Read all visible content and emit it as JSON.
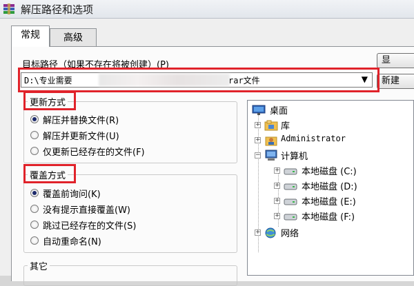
{
  "window": {
    "title": "解压路径和选项"
  },
  "tabs": [
    {
      "label": "常规"
    },
    {
      "label": "高级"
    }
  ],
  "path": {
    "label": "目标路径（如果不存在将被创建）(P)",
    "value_start": "D:\\专业需要",
    "value_end": "rar文件"
  },
  "side_buttons": [
    {
      "label": "显"
    },
    {
      "label": "新建"
    }
  ],
  "update_group": {
    "title": "更新方式",
    "options": [
      {
        "label": "解压并替换文件(R)",
        "checked": true
      },
      {
        "label": "解压并更新文件(U)",
        "checked": false
      },
      {
        "label": "仅更新已经存在的文件(F)",
        "checked": false
      }
    ]
  },
  "overwrite_group": {
    "title": "覆盖方式",
    "options": [
      {
        "label": "覆盖前询问(K)",
        "checked": true
      },
      {
        "label": "没有提示直接覆盖(W)",
        "checked": false
      },
      {
        "label": "跳过已经存在的文件(S)",
        "checked": false
      },
      {
        "label": "自动重命名(N)",
        "checked": false
      }
    ]
  },
  "other_group": {
    "title": "其它"
  },
  "tree": {
    "root": "桌面",
    "items": [
      {
        "label": "库",
        "icon": "library-icon"
      },
      {
        "label": "Administrator",
        "icon": "user-folder-icon"
      },
      {
        "label": "计算机",
        "icon": "computer-icon"
      },
      {
        "label": "本地磁盘 (C:)",
        "icon": "drive-icon"
      },
      {
        "label": "本地磁盘 (D:)",
        "icon": "drive-icon"
      },
      {
        "label": "本地磁盘 (E:)",
        "icon": "drive-icon"
      },
      {
        "label": "本地磁盘 (F:)",
        "icon": "drive-icon"
      },
      {
        "label": "网络",
        "icon": "network-icon"
      }
    ]
  },
  "colors": {
    "highlight": "#e0222a",
    "title_bar": "#e9ecf0"
  }
}
